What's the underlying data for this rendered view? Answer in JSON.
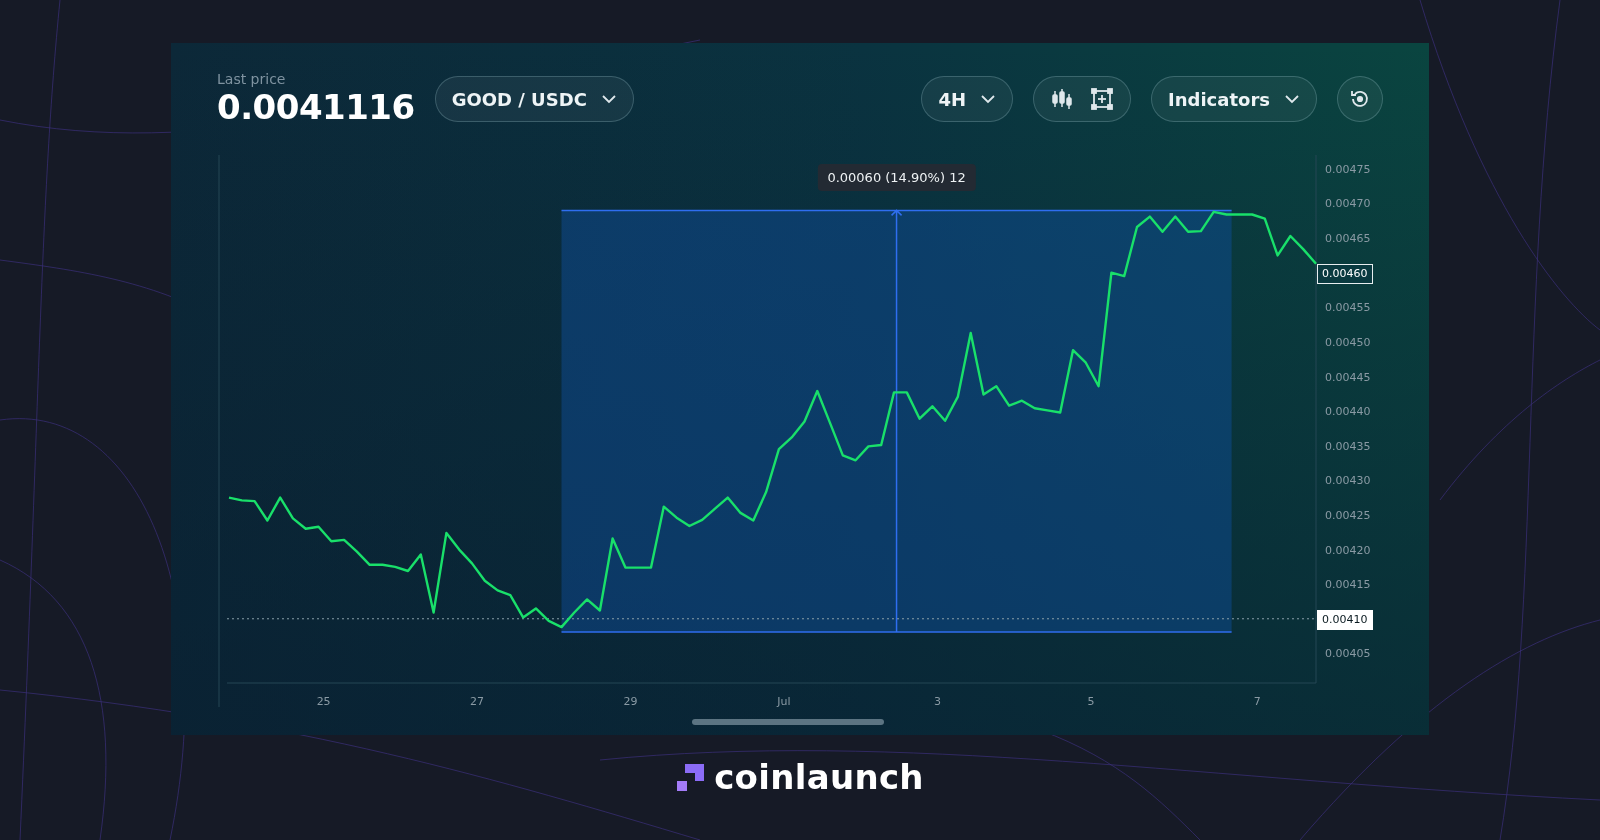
{
  "header": {
    "last_price_label": "Last price",
    "last_price": "0.0041116",
    "pair": "GOOD / USDC",
    "interval": "4H",
    "indicators": "Indicators"
  },
  "chart_data": {
    "type": "line",
    "ylim": [
      0.004,
      0.00477
    ],
    "categories": [
      null,
      null,
      null,
      null,
      null,
      null,
      null,
      "25",
      null,
      null,
      null,
      null,
      null,
      null,
      null,
      null,
      null,
      null,
      null,
      "27",
      null,
      null,
      null,
      null,
      null,
      null,
      null,
      null,
      null,
      null,
      null,
      "29",
      null,
      null,
      null,
      null,
      null,
      null,
      null,
      null,
      null,
      null,
      null,
      "Jul",
      null,
      null,
      null,
      null,
      null,
      null,
      null,
      null,
      null,
      null,
      null,
      "3",
      null,
      null,
      null,
      null,
      null,
      null,
      null,
      null,
      null,
      null,
      null,
      "5",
      null,
      null,
      null,
      null,
      null,
      null,
      null,
      null,
      null,
      null,
      null,
      null,
      "7",
      null,
      null,
      null,
      null,
      null
    ],
    "yticks": [
      {
        "value": 0.00475,
        "label": "0.00475"
      },
      {
        "value": 0.0047,
        "label": "0.00470"
      },
      {
        "value": 0.00465,
        "label": "0.00465"
      },
      {
        "value": 0.00455,
        "label": "0.00455"
      },
      {
        "value": 0.0045,
        "label": "0.00450"
      },
      {
        "value": 0.00445,
        "label": "0.00445"
      },
      {
        "value": 0.0044,
        "label": "0.00440"
      },
      {
        "value": 0.00435,
        "label": "0.00435"
      },
      {
        "value": 0.0043,
        "label": "0.00430"
      },
      {
        "value": 0.00425,
        "label": "0.00425"
      },
      {
        "value": 0.0042,
        "label": "0.00420"
      },
      {
        "value": 0.00415,
        "label": "0.00415"
      },
      {
        "value": 0.00405,
        "label": "0.00405"
      }
    ],
    "series": [
      {
        "color": "#19e06a",
        "values": [
          0.004275,
          0.004271,
          0.00427,
          0.004242,
          0.004275,
          0.004245,
          0.00423,
          0.004233,
          0.004212,
          0.004214,
          0.004197,
          0.004178,
          0.004178,
          0.004175,
          0.004169,
          0.004193,
          0.004109,
          0.004224,
          0.0042,
          0.00418,
          0.004155,
          0.004141,
          0.004134,
          0.004102,
          0.004115,
          0.004097,
          0.004088,
          0.004109,
          0.004128,
          0.004112,
          0.004216,
          0.004174,
          0.004174,
          0.004174,
          0.004262,
          0.004246,
          0.004234,
          0.004243,
          0.004259,
          0.004275,
          0.004253,
          0.004242,
          0.004283,
          0.004345,
          0.004362,
          0.004385,
          0.004429,
          0.004383,
          0.004336,
          0.004329,
          0.004349,
          0.004351,
          0.004427,
          0.004427,
          0.004389,
          0.004407,
          0.004386,
          0.004421,
          0.004513,
          0.004424,
          0.004436,
          0.004408,
          0.004415,
          0.004404,
          0.004401,
          0.004398,
          0.004488,
          0.00447,
          0.004436,
          0.0046,
          0.004595,
          0.004666,
          0.004681,
          0.004659,
          0.004681,
          0.004659,
          0.00466,
          0.004688,
          0.004684,
          0.004684,
          0.004684,
          0.004678,
          0.004625,
          0.004653,
          0.004634,
          0.004613
        ]
      }
    ]
  },
  "measure": {
    "label": "0.00060 (14.90%) 12"
  },
  "price_tags": [
    {
      "label": "0.00460"
    },
    {
      "label": "0.00410"
    }
  ],
  "brand": {
    "name": "coinlaunch"
  }
}
